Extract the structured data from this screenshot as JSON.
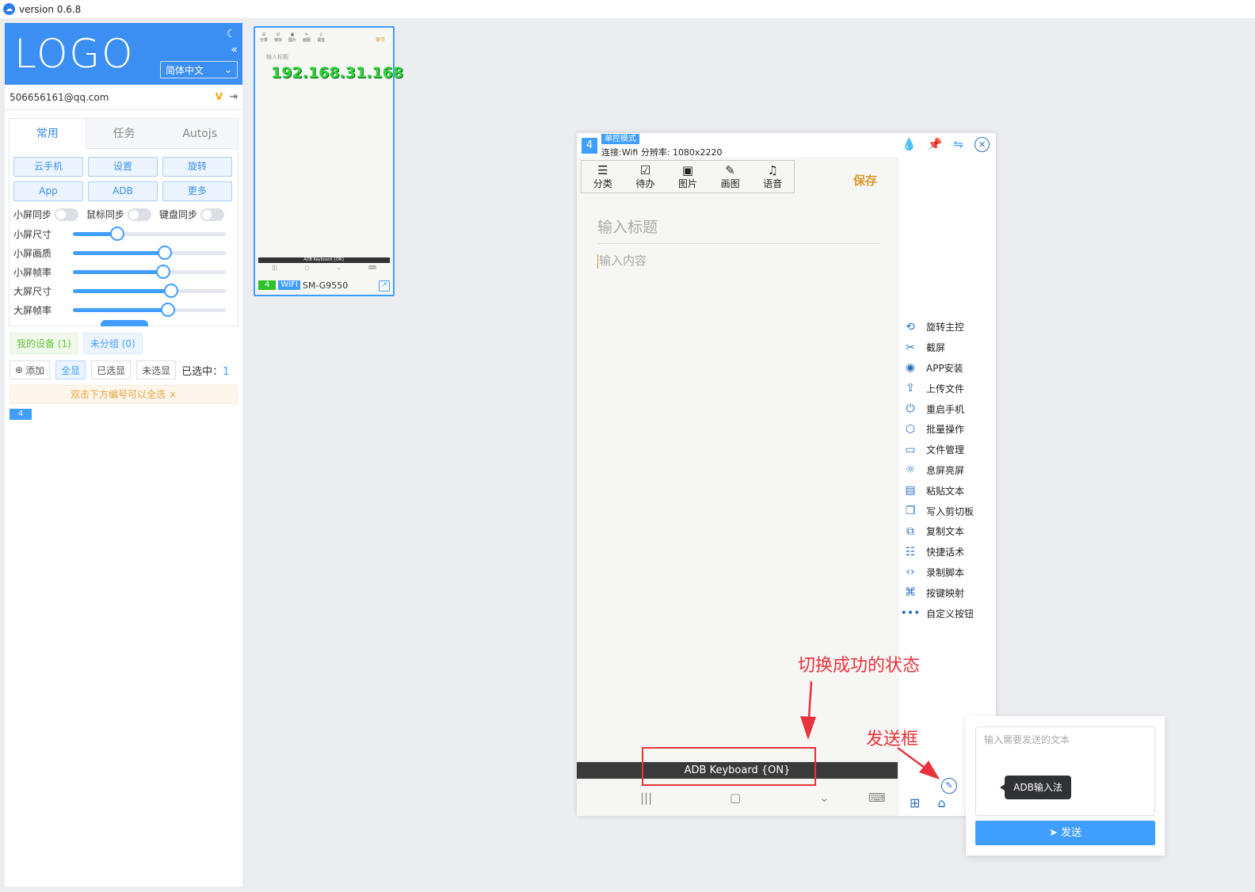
{
  "app": {
    "version": "version 0.6.8"
  },
  "sidebar": {
    "logo": "LOGO",
    "language": "简体中文",
    "account": "506656161@qq.com",
    "tabs": [
      "常用",
      "任务",
      "Autojs"
    ],
    "buttons": [
      "云手机",
      "设置",
      "旋转",
      "App",
      "ADB",
      "更多"
    ],
    "toggles": [
      "小屏同步",
      "鼠标同步",
      "键盘同步"
    ],
    "sliders": [
      {
        "label": "小屏尺寸",
        "value": 0.29
      },
      {
        "label": "小屏画质",
        "value": 0.6
      },
      {
        "label": "小屏帧率",
        "value": 0.59
      },
      {
        "label": "大屏尺寸",
        "value": 0.64
      },
      {
        "label": "大屏帧率",
        "value": 0.62
      }
    ],
    "groups": {
      "mine": "我的设备 (1)",
      "ungrouped": "未分组 (0)"
    },
    "actions": {
      "add": "添加",
      "show_all": "全显",
      "show_selected": "已选显",
      "show_unselected": "未选显",
      "selected_label": "已选中：",
      "selected_count": "1"
    },
    "hint": "双击下方编号可以全选",
    "device_chip": "4"
  },
  "thumbnail": {
    "toolbar": [
      "分类",
      "待办",
      "图片",
      "画图",
      "语音"
    ],
    "save": "保存",
    "title_placeholder": "输入标题",
    "ip": "192.168.31.168",
    "keyboard": "ADB Keyboard {ON}",
    "num": "4",
    "wifi": "WIFI",
    "model": "SM-G9550"
  },
  "control": {
    "num": "4",
    "mode": "单控模式",
    "connection": "连接:Wifi 分辨率: 1080x2220",
    "phone": {
      "toolbar": [
        {
          "icon": "list-icon",
          "label": "分类"
        },
        {
          "icon": "checkbox-icon",
          "label": "待办"
        },
        {
          "icon": "image-icon",
          "label": "图片"
        },
        {
          "icon": "pencil-icon",
          "label": "画图"
        },
        {
          "icon": "mic-icon",
          "label": "语音"
        }
      ],
      "save": "保存",
      "title_placeholder": "输入标题",
      "content_placeholder": "输入内容",
      "keyboard": "ADB Keyboard {ON}"
    },
    "menu": [
      {
        "icon": "rotate-icon",
        "label": "旋转主控"
      },
      {
        "icon": "screenshot-icon",
        "label": "截屏"
      },
      {
        "icon": "android-icon",
        "label": "APP安装"
      },
      {
        "icon": "upload-icon",
        "label": "上传文件"
      },
      {
        "icon": "power-icon",
        "label": "重启手机"
      },
      {
        "icon": "cube-icon",
        "label": "批量操作"
      },
      {
        "icon": "folder-icon",
        "label": "文件管理"
      },
      {
        "icon": "brightness-icon",
        "label": "息屏亮屏"
      },
      {
        "icon": "paste-icon",
        "label": "粘贴文本"
      },
      {
        "icon": "clipboard-icon",
        "label": "写入剪切板"
      },
      {
        "icon": "copy-icon",
        "label": "复制文本"
      },
      {
        "icon": "chat-icon",
        "label": "快捷话术"
      },
      {
        "icon": "code-icon",
        "label": "录制脚本"
      },
      {
        "icon": "gamepad-icon",
        "label": "按键映射"
      },
      {
        "icon": "more-icon",
        "label": "自定义按钮"
      }
    ]
  },
  "annotations": {
    "state": "切换成功的状态",
    "sendbox": "发送框"
  },
  "send": {
    "placeholder": "输入需要发送的文本",
    "tooltip": "ADB输入法",
    "button": "发送"
  }
}
